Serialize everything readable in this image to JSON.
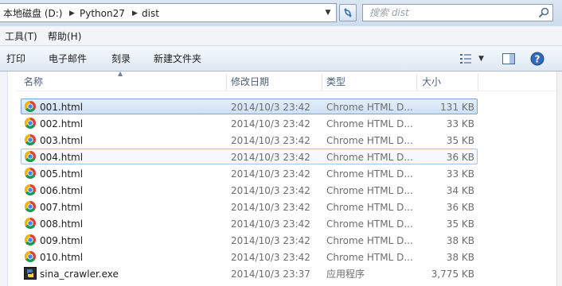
{
  "address": {
    "crumbs": [
      "本地磁盘 (D:)",
      "Python27",
      "dist"
    ],
    "search_placeholder": "搜索 dist"
  },
  "menu": [
    "工具(T)",
    "帮助(H)"
  ],
  "toolbar": {
    "print": "打印",
    "email": "电子邮件",
    "burn": "刻录",
    "new_folder": "新建文件夹"
  },
  "columns": {
    "name": "名称",
    "modified": "修改日期",
    "type": "类型",
    "size": "大小"
  },
  "files": [
    {
      "name": "001.html",
      "date": "2014/10/3 23:42",
      "type": "Chrome HTML D...",
      "size": "131 KB",
      "icon": "chrome-icon"
    },
    {
      "name": "002.html",
      "date": "2014/10/3 23:42",
      "type": "Chrome HTML D...",
      "size": "33 KB",
      "icon": "chrome-icon"
    },
    {
      "name": "003.html",
      "date": "2014/10/3 23:42",
      "type": "Chrome HTML D...",
      "size": "35 KB",
      "icon": "chrome-icon"
    },
    {
      "name": "004.html",
      "date": "2014/10/3 23:42",
      "type": "Chrome HTML D...",
      "size": "36 KB",
      "icon": "chrome-icon"
    },
    {
      "name": "005.html",
      "date": "2014/10/3 23:42",
      "type": "Chrome HTML D...",
      "size": "33 KB",
      "icon": "chrome-icon"
    },
    {
      "name": "006.html",
      "date": "2014/10/3 23:42",
      "type": "Chrome HTML D...",
      "size": "34 KB",
      "icon": "chrome-icon"
    },
    {
      "name": "007.html",
      "date": "2014/10/3 23:42",
      "type": "Chrome HTML D...",
      "size": "36 KB",
      "icon": "chrome-icon"
    },
    {
      "name": "008.html",
      "date": "2014/10/3 23:42",
      "type": "Chrome HTML D...",
      "size": "35 KB",
      "icon": "chrome-icon"
    },
    {
      "name": "009.html",
      "date": "2014/10/3 23:42",
      "type": "Chrome HTML D...",
      "size": "38 KB",
      "icon": "chrome-icon"
    },
    {
      "name": "010.html",
      "date": "2014/10/3 23:42",
      "type": "Chrome HTML D...",
      "size": "38 KB",
      "icon": "chrome-icon"
    },
    {
      "name": "sina_crawler.exe",
      "date": "2014/10/3 23:37",
      "type": "应用程序",
      "size": "3,775 KB",
      "icon": "python-exe-icon"
    }
  ],
  "selected_row": 0,
  "hover_row": 3,
  "colors": {
    "selection_bg": "#cfe0f6",
    "selection_border": "#7da2ce",
    "header_text": "#4c607a",
    "meta_text": "#6d6d6d"
  }
}
